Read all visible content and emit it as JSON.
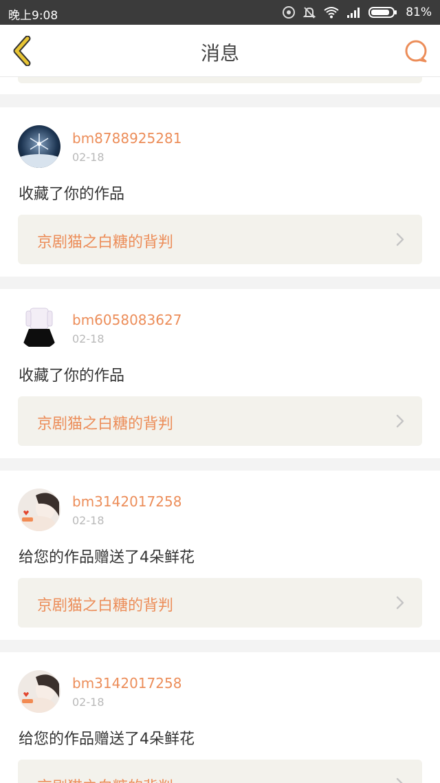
{
  "status_bar": {
    "time": "晚上9:08",
    "battery": "81%",
    "icons": [
      "hotspot-icon",
      "mute-bell-icon",
      "wifi-icon",
      "signal-icon",
      "battery-icon"
    ]
  },
  "header": {
    "title": "消息",
    "back_icon": "back-chevron-icon",
    "right_icon": "chat-bubble-icon",
    "accent_color": "#ec8d59",
    "back_color": "#e8c534"
  },
  "messages": [
    {
      "username": "bm8788925281",
      "date": "02-18",
      "action": "收藏了你的作品",
      "work_title": "京剧猫之白糖的背判",
      "avatar": "snowflake-avatar"
    },
    {
      "username": "bm6058083627",
      "date": "02-18",
      "action": "收藏了你的作品",
      "work_title": "京剧猫之白糖的背判",
      "avatar": "girl-black-skirt-avatar"
    },
    {
      "username": "bm3142017258",
      "date": "02-18",
      "action": "给您的作品赠送了4朵鲜花",
      "work_title": "京剧猫之白糖的背判",
      "avatar": "girl-photo-avatar"
    },
    {
      "username": "bm3142017258",
      "date": "02-18",
      "action": "给您的作品赠送了4朵鲜花",
      "work_title": "京剧猫之白糖的背判",
      "avatar": "girl-photo-avatar"
    }
  ]
}
